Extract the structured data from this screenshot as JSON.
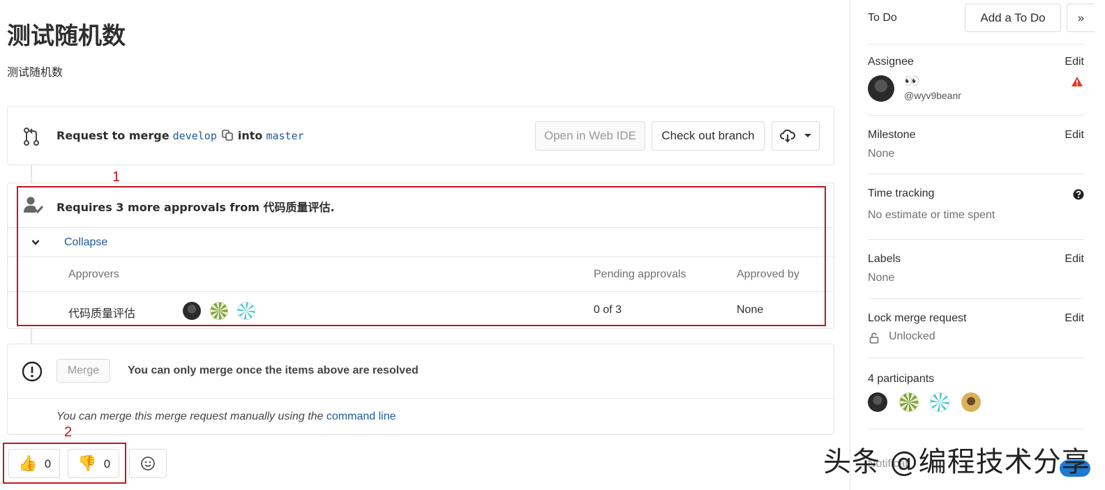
{
  "issue": {
    "title": "测试随机数",
    "description": "测试随机数"
  },
  "merge_request": {
    "request_to_merge": "Request to merge",
    "source_branch": "develop",
    "into": "into",
    "target_branch": "master",
    "open_web_ide": "Open in Web IDE",
    "check_out_branch": "Check out branch"
  },
  "approvals": {
    "summary": "Requires 3 more approvals from 代码质量评估.",
    "collapse": "Collapse",
    "headers": {
      "approvers": "Approvers",
      "pending": "Pending approvals",
      "approved_by": "Approved by"
    },
    "rows": [
      {
        "group": "代码质量评估",
        "pending": "0 of 3",
        "approved_by": "None"
      }
    ]
  },
  "merge_widget": {
    "merge_button": "Merge",
    "message": "You can only merge once the items above are resolved",
    "manual_prefix": "You can merge this merge request manually using the",
    "command_line": "command line"
  },
  "reactions": {
    "thumbs_up_count": "0",
    "thumbs_down_count": "0"
  },
  "annotations": {
    "marker_1": "1",
    "marker_2": "2"
  },
  "sidebar": {
    "todo_label": "To Do",
    "add_todo": "Add a To Do",
    "collapse_glyph": "»",
    "assignee": {
      "label": "Assignee",
      "edit": "Edit",
      "name_glyph": "👀",
      "username": "@wyv9beanr"
    },
    "milestone": {
      "label": "Milestone",
      "edit": "Edit",
      "value": "None"
    },
    "time_tracking": {
      "label": "Time tracking",
      "value": "No estimate or time spent"
    },
    "labels": {
      "label": "Labels",
      "edit": "Edit",
      "value": "None"
    },
    "lock": {
      "label": "Lock merge request",
      "edit": "Edit",
      "value": "Unlocked"
    },
    "participants": {
      "label": "4 participants"
    },
    "notifications_partial": "Notificati"
  },
  "watermark": "头条 @编程技术分享",
  "colors": {
    "link": "#1f5a99",
    "annotation_red": "#c0171d",
    "warning_red": "#db3b21",
    "border": "#e5e5e5"
  }
}
